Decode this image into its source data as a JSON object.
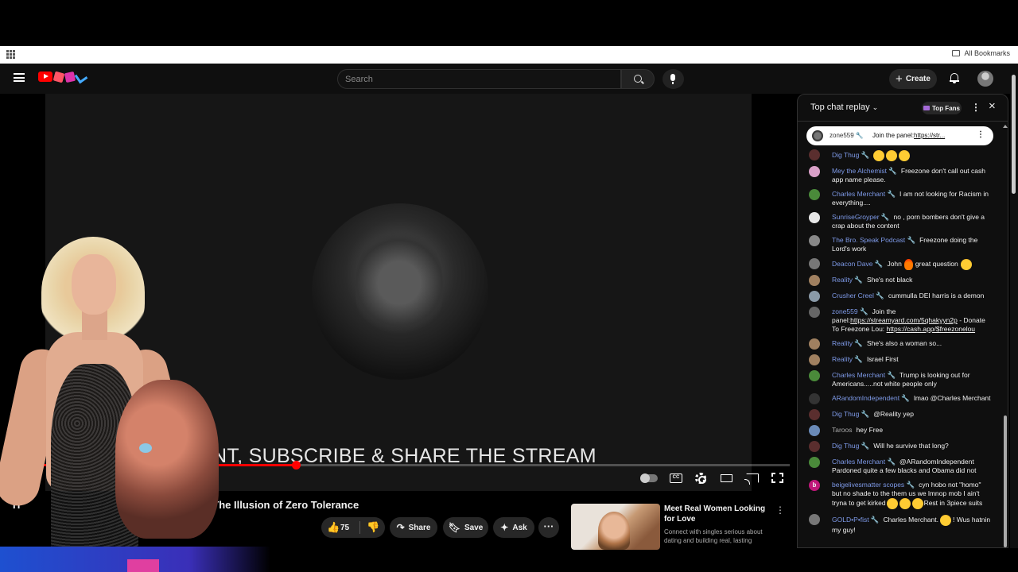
{
  "browser": {
    "bookmarks_label": "All Bookmarks"
  },
  "header": {
    "search_placeholder": "Search",
    "create_label": "Create"
  },
  "video": {
    "caption_overlay": "ENT, SUBSCRIBE & SHARE THE STREAM",
    "progress": 0.365,
    "title_prefix": "H",
    "title": "| The Illusion of Zero Tolerance"
  },
  "actions": {
    "like_count": "75",
    "share_label": "Share",
    "save_label": "Save",
    "ask_label": "Ask"
  },
  "ad": {
    "title": "Meet Real Women Looking for Love",
    "description": "Connect with singles serious about dating and building real, lasting"
  },
  "chat": {
    "header_title": "Top chat replay",
    "top_fans_label": "Top Fans",
    "pinned": {
      "author": "zone559 🔧",
      "message": "Join the panel:",
      "link": "https://str..."
    },
    "messages": [
      {
        "author": "Dig Thug 🔧",
        "text": "",
        "emoji": 3,
        "avatar": "#5a2e2e"
      },
      {
        "author": "Mey the Alchemist 🔧",
        "text": "Freezone don't call out cash app name please.",
        "avatar": "#d9a0c8"
      },
      {
        "author": "Charles Merchant 🔧",
        "text": "I am not looking for Racism in everything....",
        "avatar": "#4a8a3a"
      },
      {
        "author": "SunriseGroyper 🔧",
        "text": "no , porn bombers don't give a crap about the content",
        "avatar": "#e8e8e8"
      },
      {
        "author": "The Bro. Speak Podcast 🔧",
        "text": "Freezone doing the Lord's work",
        "avatar": "#888888"
      },
      {
        "author": "Deacon Dave 🔧",
        "text": "John",
        "text2": "great question",
        "avatar": "#777777"
      },
      {
        "author": "Reality 🔧",
        "text": "She's not black",
        "avatar": "#a08060"
      },
      {
        "author": "Crusher Creel 🔧",
        "text": "cummulla DEI harris is a demon",
        "avatar": "#8a9aa8"
      },
      {
        "author": "zone559 🔧",
        "text": "Join the panel:",
        "link": "https://streamyard.com/5qhakyyn2p",
        "text2": " - Donate To Freezone Lou: ",
        "link2": "https://cash.app/$freezonelou",
        "avatar": "#666666"
      },
      {
        "author": "Reality 🔧",
        "text": "She's also a woman so...",
        "avatar": "#a08060"
      },
      {
        "author": "Reality 🔧",
        "text": "Israel First",
        "avatar": "#a08060"
      },
      {
        "author": "Charles Merchant 🔧",
        "text": "Trump is looking out for Americans.....not white people only",
        "avatar": "#4a8a3a"
      },
      {
        "author": "ARandomIndependent 🔧",
        "text": "lmao @Charles Merchant",
        "avatar": "#333333"
      },
      {
        "author": "Dig Thug 🔧",
        "text": "@Reality yep",
        "avatar": "#5a2e2e"
      },
      {
        "author": "Taroos",
        "text": "hey Free",
        "avatar": "#6a8ab8",
        "grey": true
      },
      {
        "author": "Dig Thug 🔧",
        "text": "Will he survive that long?",
        "avatar": "#5a2e2e"
      },
      {
        "author": "Charles Merchant 🔧",
        "text": "@ARandomIndependent Pardoned quite a few blacks and Obama did not",
        "avatar": "#4a8a3a"
      },
      {
        "author": "beigelivesmatter scopes 🔧",
        "text": "cyn hobo not \"homo\" but no shade to the them us we lmnop mob I ain't tryna to get kirked",
        "text2": "Rest in 3piece suits",
        "avatar": "#c0187a",
        "letter": "b"
      },
      {
        "author": "GOLD•P•fist 🔧",
        "text": "Charles Merchant.",
        "text2": "! Wus hatnin my guy!",
        "avatar": "#777777"
      }
    ]
  }
}
